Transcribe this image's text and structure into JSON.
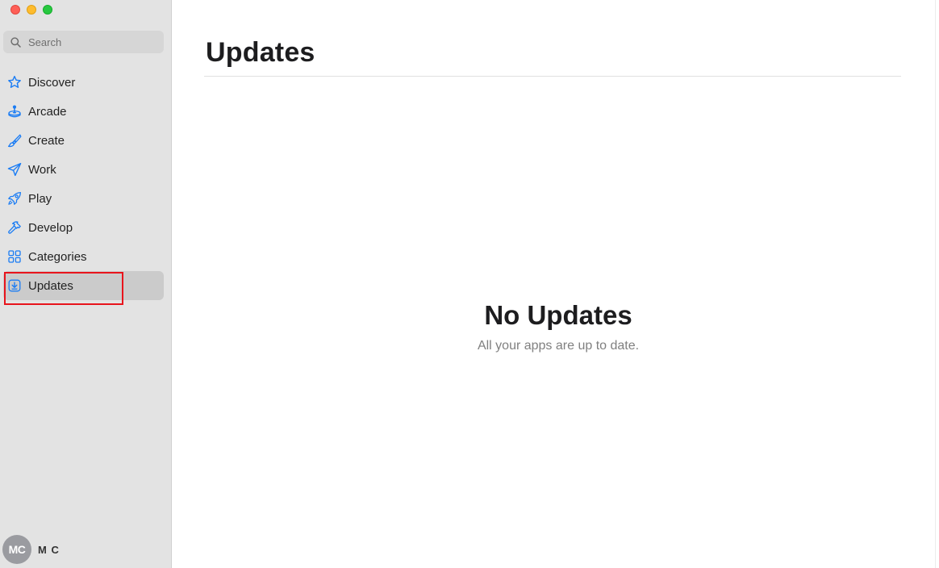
{
  "window": {
    "traffic_lights": [
      "close",
      "minimize",
      "zoom"
    ]
  },
  "sidebar": {
    "search": {
      "placeholder": "Search",
      "icon": "search-icon"
    },
    "items": [
      {
        "label": "Discover",
        "icon": "star-icon"
      },
      {
        "label": "Arcade",
        "icon": "joystick-icon"
      },
      {
        "label": "Create",
        "icon": "paintbrush-icon"
      },
      {
        "label": "Work",
        "icon": "paperplane-icon"
      },
      {
        "label": "Play",
        "icon": "rocket-icon"
      },
      {
        "label": "Develop",
        "icon": "hammer-icon"
      },
      {
        "label": "Categories",
        "icon": "grid-icon"
      },
      {
        "label": "Updates",
        "icon": "download-icon",
        "selected": true
      }
    ],
    "account": {
      "initials": "MC",
      "name": "M C"
    }
  },
  "main": {
    "title": "Updates",
    "empty_title": "No Updates",
    "empty_subtitle": "All your apps are up to date."
  },
  "colors": {
    "accent": "#1a7cf4",
    "sidebar_bg": "#e3e3e3",
    "selected_bg": "#cbcbcb",
    "highlight": "#e8141c"
  }
}
